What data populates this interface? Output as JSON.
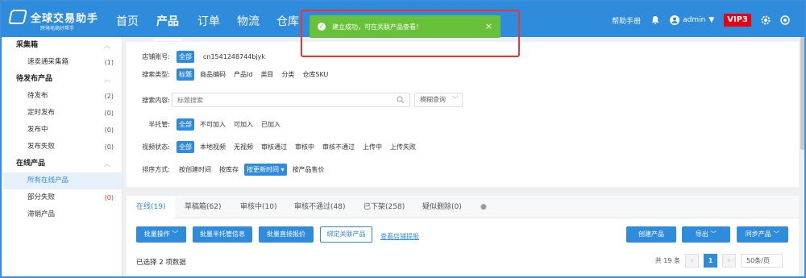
{
  "colors": {
    "primary": "#2f8bdc",
    "success": "#67c23a",
    "vip": "#e60012",
    "highlight": "#e33333"
  },
  "app": {
    "logo_title": "全球交易助手",
    "logo_sub": "跨境电商好帮手"
  },
  "nav": [
    "首页",
    "产品",
    "订单",
    "物流",
    "仓库"
  ],
  "nav_active": "产品",
  "header_right": {
    "help": "帮助手册",
    "user": "admin",
    "vip": "VIP3"
  },
  "toast": {
    "message": "建立成功，可在关联产品查看！",
    "close": "×",
    "icon": "check-circle-icon"
  },
  "sidebar": {
    "groups": [
      {
        "title": "采集箱",
        "items": [
          {
            "label": "速卖通采集箱",
            "count": "(1)"
          }
        ]
      },
      {
        "title": "待发布产品",
        "items": [
          {
            "label": "待发布",
            "count": "(2)"
          },
          {
            "label": "定时发布",
            "count": "(0)"
          },
          {
            "label": "发布中",
            "count": "(0)"
          },
          {
            "label": "发布失败",
            "count": "(0)"
          }
        ]
      },
      {
        "title": "在线产品",
        "items": [
          {
            "label": "所有在线产品",
            "count": ""
          },
          {
            "label": "部分失败",
            "count": "(0)"
          },
          {
            "label": "滞销产品",
            "count": ""
          }
        ]
      }
    ]
  },
  "filters": {
    "store": {
      "label": "店铺账号:",
      "options": [
        "全部",
        "cn1541248744bjyk"
      ]
    },
    "search_type": {
      "label": "搜索类型:",
      "options": [
        "标题",
        "商品编码",
        "产品Id",
        "类目",
        "分类",
        "仓库SKU"
      ]
    },
    "search_content": {
      "label": "搜索内容:",
      "placeholder": "标题搜索",
      "mode": "模糊查询"
    },
    "consign": {
      "label": "半托管:",
      "options": [
        "全部",
        "不可加入",
        "可加入",
        "已加入"
      ]
    },
    "video": {
      "label": "视频状态:",
      "options": [
        "全部",
        "本地视频",
        "无视频",
        "审核通过",
        "审核中",
        "审核不通过",
        "上传中",
        "上传失败"
      ]
    },
    "sort": {
      "label": "排序方式:",
      "options": [
        "按创建时间",
        "按库存",
        "按更新时间 ▾",
        "按产品售价"
      ]
    }
  },
  "tabs": [
    "在线(19)",
    "草稿箱(62)",
    "审核中(10)",
    "审核不通过(48)",
    "已下架(258)",
    "疑似删除(0)"
  ],
  "actions": {
    "batch_ops": "批量操作",
    "batch_consign": "批量半托管信息",
    "batch_price": "批量直接报价",
    "bind": "绑定关联产品",
    "view_store": "查看店铺提报",
    "create": "创建产品",
    "export": "导出",
    "sync": "同步产品"
  },
  "selection": "已选择 2 项数据",
  "pager": {
    "total": "共 19 条",
    "current": "1",
    "size": "50条/页"
  }
}
